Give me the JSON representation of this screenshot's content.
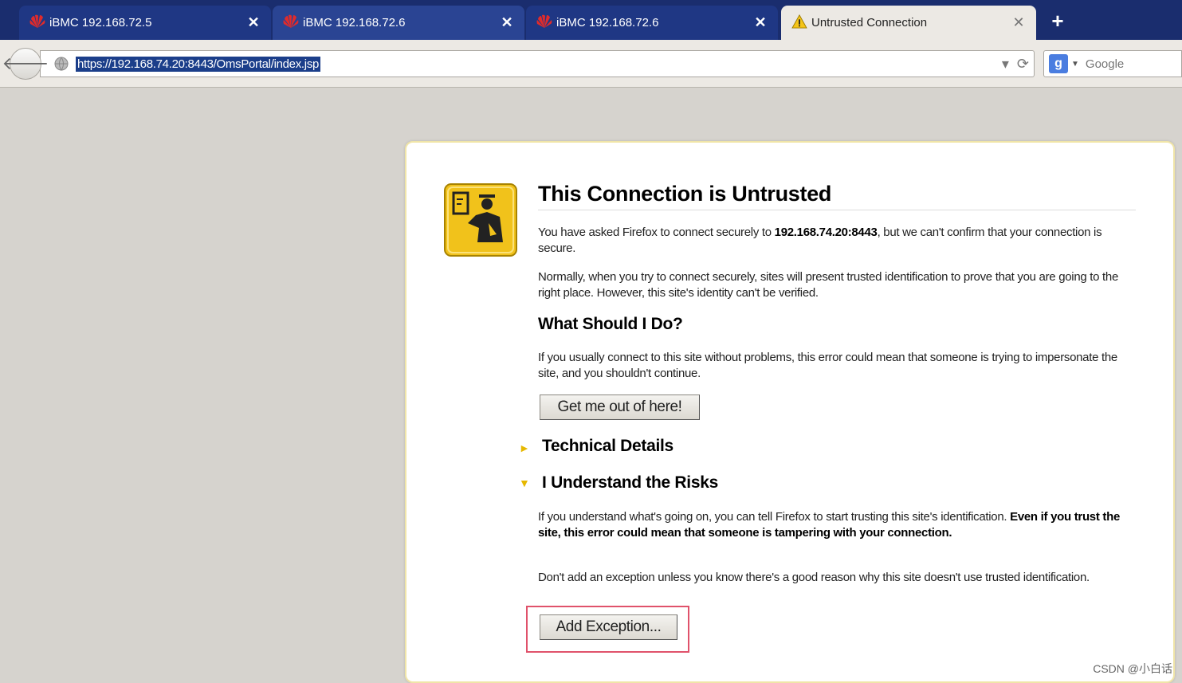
{
  "tabs": [
    {
      "title": "iBMC 192.168.72.5",
      "close": "✕",
      "favicon": "huawei-logo-icon"
    },
    {
      "title": "iBMC 192.168.72.6",
      "close": "✕",
      "favicon": "huawei-logo-icon"
    },
    {
      "title": "iBMC 192.168.72.6",
      "close": "✕",
      "favicon": "huawei-logo-icon"
    },
    {
      "title": "Untrusted Connection",
      "close": "✕",
      "favicon": "warning-icon"
    }
  ],
  "new_tab": "+",
  "nav": {
    "back": "🡐",
    "url": "https://192.168.74.20:8443/OmsPortal/index.jsp",
    "dropdown": "▾",
    "reload": "⟳"
  },
  "search": {
    "engine_letter": "g",
    "caret": "▼",
    "placeholder": "Google"
  },
  "page": {
    "title": "This Connection is Untrusted",
    "intro_before": "You have asked Firefox to connect securely to ",
    "intro_host": "192.168.74.20:8443",
    "intro_after": ", but we can't confirm that your connection is secure.",
    "normally": "Normally, when you try to connect securely, sites will present trusted identification to prove that you are going to the right place. However, this site's identity can't be verified.",
    "what_heading": "What Should I Do?",
    "what_text": "If you usually connect to this site without problems, this error could mean that someone is trying to impersonate the site, and you shouldn't continue.",
    "get_out_button": "Get me out of here!",
    "technical_details": "Technical Details",
    "risks_heading": "I Understand the Risks",
    "risks_text_before": "If you understand what's going on, you can tell Firefox to start trusting this site's identification. ",
    "risks_text_bold": "Even if you trust the site, this error could mean that someone is tampering with your connection.",
    "dont_add": "Don't add an exception unless you know there's a good reason why this site doesn't use trusted identification.",
    "add_exception_button": "Add Exception...",
    "collapsed_marker": "►",
    "expanded_marker": "▼"
  },
  "watermark": "CSDN @小白话"
}
